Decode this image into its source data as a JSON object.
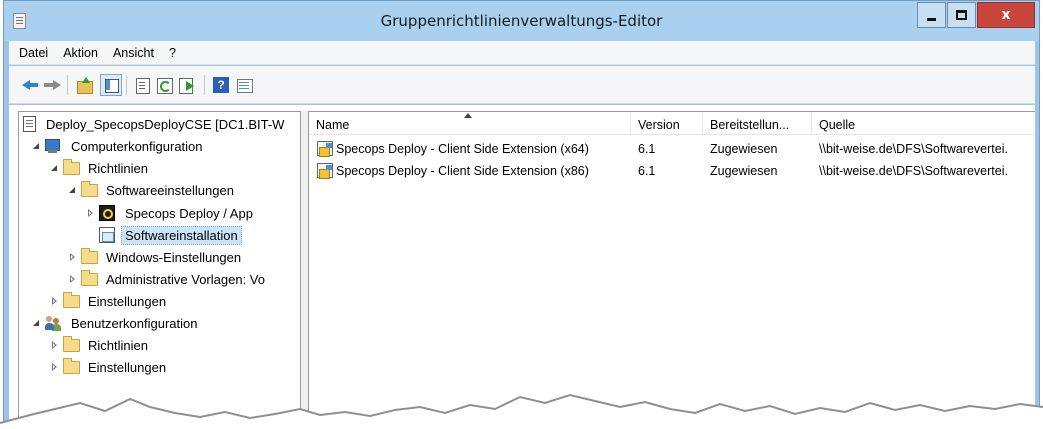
{
  "window": {
    "title": "Gruppenrichtlinienverwaltungs-Editor",
    "close_glyph": "x"
  },
  "menu": [
    "Datei",
    "Aktion",
    "Ansicht",
    "?"
  ],
  "toolbar": {
    "buttons": [
      "back-icon",
      "forward-icon",
      "up-level-icon",
      "show-tree-icon",
      "properties-icon",
      "refresh-icon",
      "export-list-icon",
      "help-icon",
      "view-icon"
    ],
    "help_glyph": "?"
  },
  "tree": [
    {
      "label": "Deploy_SpecopsDeployCSE [DC1.BIT-W",
      "icon": "document-icon",
      "level": 0
    },
    {
      "label": "Computerkonfiguration",
      "icon": "computer-icon",
      "level": 0,
      "expanded": true
    },
    {
      "label": "Richtlinien",
      "icon": "folder-icon",
      "level": 1,
      "expanded": true
    },
    {
      "label": "Softwareeinstellungen",
      "icon": "folder-icon",
      "level": 2,
      "expanded": true
    },
    {
      "label": "Specops Deploy / App",
      "icon": "specops-icon",
      "level": 3,
      "expanded": false
    },
    {
      "label": "Softwareinstallation",
      "icon": "software-install-icon",
      "level": 3,
      "selected": true
    },
    {
      "label": "Windows-Einstellungen",
      "icon": "folder-icon",
      "level": 2,
      "expanded": false
    },
    {
      "label": "Administrative Vorlagen: Vo",
      "icon": "folder-icon",
      "level": 2,
      "expanded": false
    },
    {
      "label": "Einstellungen",
      "icon": "folder-icon",
      "level": 1,
      "expanded": false
    },
    {
      "label": "Benutzerkonfiguration",
      "icon": "users-icon",
      "level": 0,
      "expanded": true
    },
    {
      "label": "Richtlinien",
      "icon": "folder-icon",
      "level": 1,
      "expanded": false
    },
    {
      "label": "Einstellungen",
      "icon": "folder-icon",
      "level": 1,
      "expanded": false
    }
  ],
  "list": {
    "columns": [
      "Name",
      "Version",
      "Bereitstellun...",
      "Quelle"
    ],
    "rows": [
      {
        "name": "Specops Deploy - Client Side Extension (x64)",
        "version": "6.1",
        "deployment": "Zugewiesen",
        "source": "\\\\bit-weise.de\\DFS\\Softwarevertei."
      },
      {
        "name": "Specops Deploy - Client Side Extension (x86)",
        "version": "6.1",
        "deployment": "Zugewiesen",
        "source": "\\\\bit-weise.de\\DFS\\Softwarevertei."
      }
    ]
  }
}
